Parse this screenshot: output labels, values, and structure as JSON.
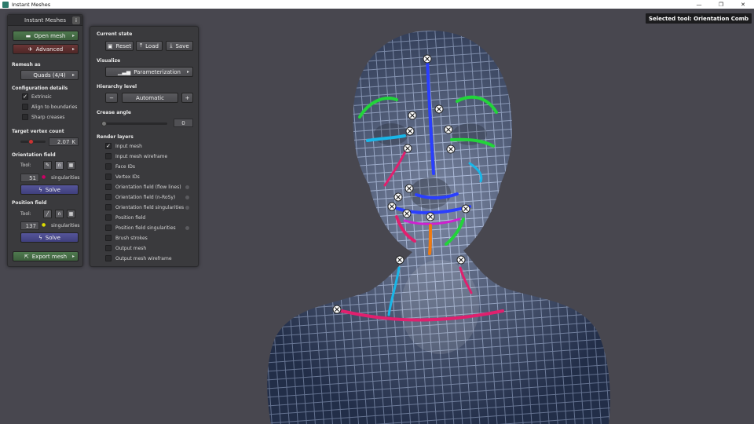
{
  "window": {
    "title": "Instant Meshes",
    "controls": [
      "—",
      "❐",
      "✕"
    ]
  },
  "overlay": {
    "selected_tool": "Selected tool: Orientation Comb"
  },
  "main_panel": {
    "title": "Instant Meshes",
    "info_label": "i",
    "open_mesh_label": "Open mesh",
    "advanced_label": "Advanced",
    "remesh_as_label": "Remesh as",
    "remesh_as_value": "Quads (4/4)",
    "config_label": "Configuration details",
    "config_options": [
      {
        "label": "Extrinsic",
        "checked": true
      },
      {
        "label": "Align to boundaries",
        "checked": false
      },
      {
        "label": "Sharp creases",
        "checked": false
      }
    ],
    "target_vertex_label": "Target vertex count",
    "target_vertex_value": "2.07",
    "target_vertex_unit": "K",
    "orientation_label": "Orientation field",
    "orientation_tool_label": "Tool:",
    "orientation_singularities": "51",
    "singularities_label": "singularities",
    "orientation_solve_label": "Solve",
    "position_label": "Position field",
    "position_tool_label": "Tool:",
    "position_singularities": "137",
    "position_solve_label": "Solve",
    "export_label": "Export mesh"
  },
  "advanced_panel": {
    "current_state_label": "Current state",
    "reset_label": "Reset",
    "load_label": "Load",
    "save_label": "Save",
    "visualize_label": "Visualize",
    "visualize_value": "Parameterization",
    "hierarchy_label": "Hierarchy level",
    "hierarchy_minus": "−",
    "hierarchy_value": "Automatic",
    "hierarchy_plus": "+",
    "crease_label": "Crease angle",
    "crease_value": "0",
    "render_layers_label": "Render layers",
    "layers": [
      {
        "label": "Input mesh",
        "checked": true,
        "dot": false
      },
      {
        "label": "Input mesh wireframe",
        "checked": false,
        "dot": false
      },
      {
        "label": "Face IDs",
        "checked": false,
        "dot": false
      },
      {
        "label": "Vertex IDs",
        "checked": false,
        "dot": false
      },
      {
        "label": "Orientation field (flow lines)",
        "checked": false,
        "dot": true
      },
      {
        "label": "Orientation field (n-RoSy)",
        "checked": false,
        "dot": true
      },
      {
        "label": "Orientation field singularities",
        "checked": false,
        "dot": true
      },
      {
        "label": "Position field",
        "checked": false,
        "dot": false
      },
      {
        "label": "Position field singularities",
        "checked": false,
        "dot": true
      },
      {
        "label": "Brush strokes",
        "checked": false,
        "dot": false
      },
      {
        "label": "Output mesh",
        "checked": false,
        "dot": false
      },
      {
        "label": "Output mesh wireframe",
        "checked": false,
        "dot": false
      }
    ]
  },
  "colors": {
    "viewport_bg": "#48474f",
    "mesh_fill": "#3a4f7a",
    "mesh_lines": "#8fa6d6",
    "stroke_blue": "#2a3fff",
    "stroke_green": "#22d43a",
    "stroke_pink": "#e0206e",
    "stroke_cyan": "#19b6e8",
    "stroke_orange": "#f07a10",
    "stroke_magenta": "#d020d0"
  }
}
